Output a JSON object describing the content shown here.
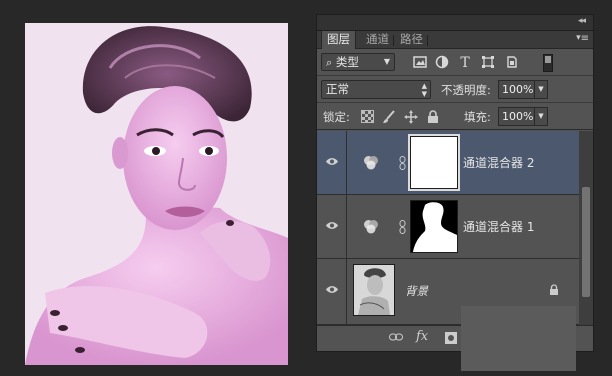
{
  "canvas": {
    "description_icon": "portrait-photo"
  },
  "panel": {
    "tabs": [
      {
        "label": "图层",
        "active": true
      },
      {
        "label": "通道",
        "active": false
      },
      {
        "label": "路径",
        "active": false
      }
    ],
    "collapse_icon": "double-chevron-icon",
    "menu_icon": "panel-menu-icon",
    "filter": {
      "kind_label": "类型",
      "icons": [
        "image-filter-icon",
        "adjustment-filter-icon",
        "text-filter-icon",
        "shape-filter-icon",
        "smart-object-filter-icon"
      ]
    },
    "blend_mode": "正常",
    "opacity_label": "不透明度:",
    "opacity_value": "100%",
    "lock_label": "锁定:",
    "fill_label": "填充:",
    "fill_value": "100%",
    "layers": [
      {
        "name": "通道混合器 2",
        "selected": true,
        "type": "adjustment",
        "mask": "white"
      },
      {
        "name": "通道混合器 1",
        "selected": false,
        "type": "adjustment",
        "mask": "silhouette"
      },
      {
        "name": "背景",
        "selected": false,
        "type": "background",
        "locked": true
      }
    ],
    "bottom_icons": [
      "link-icon",
      "fx-icon",
      "mask-icon"
    ],
    "bottom_fx_label": "fx"
  },
  "colors": {
    "panel_bg": "#535353",
    "selected_layer": "#4b586e",
    "app_bg": "#282828",
    "photo_tint": "#e9cfe7"
  }
}
